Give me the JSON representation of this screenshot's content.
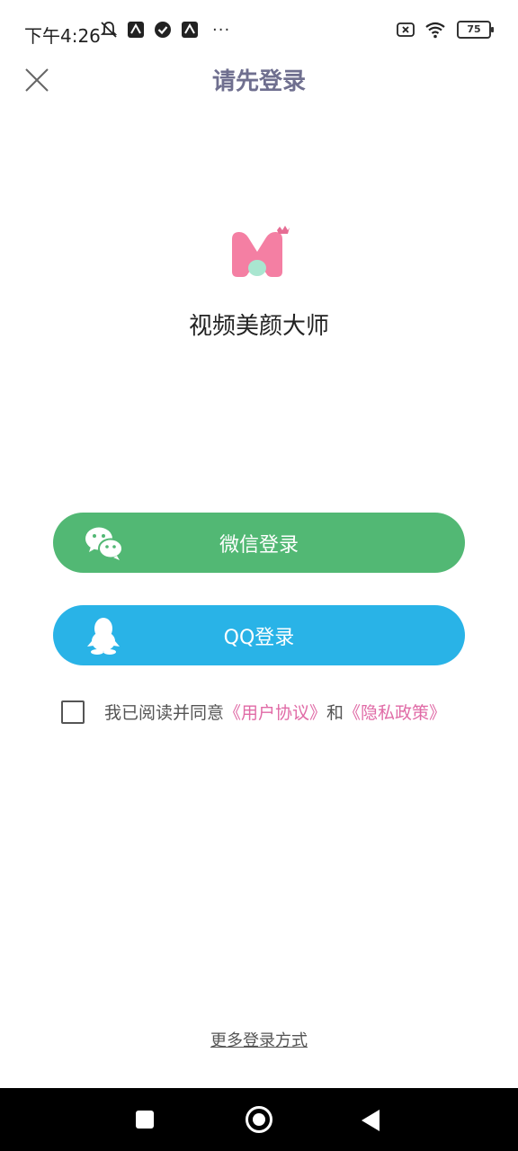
{
  "status_bar": {
    "time": "下午4:26",
    "more": "···",
    "battery": "75",
    "icons": [
      "mute-icon",
      "app-icon",
      "check-icon",
      "app-icon",
      "sim-off-icon",
      "wifi-icon",
      "battery-icon"
    ]
  },
  "header": {
    "title": "请先登录",
    "close_icon": "close-icon"
  },
  "app": {
    "name": "视频美颜大师",
    "logo_colors": {
      "pink": "#f47fa3",
      "mint": "#a9e6d0",
      "crown": "#e66d94"
    }
  },
  "buttons": {
    "wechat": {
      "label": "微信登录",
      "color": "#52b874",
      "icon": "wechat-icon"
    },
    "qq": {
      "label": "QQ登录",
      "color": "#29b3e7",
      "icon": "qq-icon"
    }
  },
  "agreement": {
    "text_before": "我已阅读并同意",
    "user_agreement": "《用户协议》",
    "conjunction": "和",
    "privacy_policy": "《隐私政策》",
    "link_color": "#e06aa6"
  },
  "more_login": "更多登录方式",
  "nav": {
    "recent": "recent-apps-icon",
    "home": "home-icon",
    "back": "back-icon"
  }
}
